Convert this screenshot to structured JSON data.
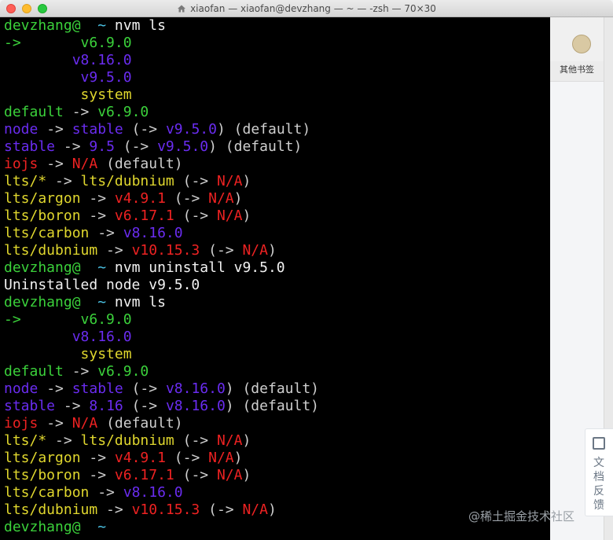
{
  "window": {
    "title": "xiaofan — xiaofan@devzhang — ~ — -zsh — 70×30"
  },
  "browser_bg": {
    "bookmark_label": "其他书签",
    "feedback_label": "文档反馈"
  },
  "watermark": "@稀土掘金技术社区",
  "colors": {
    "prompt_green": "#3bd13b",
    "version_purple": "#6a2cf0",
    "yellow": "#e0d72e",
    "red": "#ee2222",
    "cyan": "#4cc6e8"
  },
  "terminal": {
    "lines": [
      [
        {
          "t": "devzhang@",
          "c": "c-green"
        },
        {
          "t": "  ~ ",
          "c": "c-cyan"
        },
        {
          "t": "nvm ls",
          "c": "c-white"
        }
      ],
      [
        {
          "t": "->",
          "c": "c-green"
        },
        {
          "t": "       v6.9.0",
          "c": "c-green"
        }
      ],
      [
        {
          "t": "        v8.16.0",
          "c": "c-purple"
        }
      ],
      [
        {
          "t": "         v9.5.0",
          "c": "c-purple"
        }
      ],
      [
        {
          "t": "         system",
          "c": "c-yellow"
        }
      ],
      [
        {
          "t": "default",
          "c": "c-green"
        },
        {
          "t": " -> ",
          "c": "c-dim"
        },
        {
          "t": "v6.9.0",
          "c": "c-green"
        }
      ],
      [
        {
          "t": "node",
          "c": "c-purple"
        },
        {
          "t": " -> ",
          "c": "c-dim"
        },
        {
          "t": "stable",
          "c": "c-purple"
        },
        {
          "t": " (-> ",
          "c": "c-dim"
        },
        {
          "t": "v9.5.0",
          "c": "c-purple"
        },
        {
          "t": ") (default)",
          "c": "c-dim"
        }
      ],
      [
        {
          "t": "stable",
          "c": "c-purple"
        },
        {
          "t": " -> ",
          "c": "c-dim"
        },
        {
          "t": "9.5",
          "c": "c-purple"
        },
        {
          "t": " (-> ",
          "c": "c-dim"
        },
        {
          "t": "v9.5.0",
          "c": "c-purple"
        },
        {
          "t": ") (default)",
          "c": "c-dim"
        }
      ],
      [
        {
          "t": "iojs",
          "c": "c-red"
        },
        {
          "t": " -> ",
          "c": "c-dim"
        },
        {
          "t": "N/A",
          "c": "c-red"
        },
        {
          "t": " (default)",
          "c": "c-dim"
        }
      ],
      [
        {
          "t": "lts/*",
          "c": "c-yellow"
        },
        {
          "t": " -> ",
          "c": "c-dim"
        },
        {
          "t": "lts/dubnium",
          "c": "c-yellow"
        },
        {
          "t": " (-> ",
          "c": "c-dim"
        },
        {
          "t": "N/A",
          "c": "c-red"
        },
        {
          "t": ")",
          "c": "c-dim"
        }
      ],
      [
        {
          "t": "lts/argon",
          "c": "c-yellow"
        },
        {
          "t": " -> ",
          "c": "c-dim"
        },
        {
          "t": "v4.9.1",
          "c": "c-red"
        },
        {
          "t": " (-> ",
          "c": "c-dim"
        },
        {
          "t": "N/A",
          "c": "c-red"
        },
        {
          "t": ")",
          "c": "c-dim"
        }
      ],
      [
        {
          "t": "lts/boron",
          "c": "c-yellow"
        },
        {
          "t": " -> ",
          "c": "c-dim"
        },
        {
          "t": "v6.17.1",
          "c": "c-red"
        },
        {
          "t": " (-> ",
          "c": "c-dim"
        },
        {
          "t": "N/A",
          "c": "c-red"
        },
        {
          "t": ")",
          "c": "c-dim"
        }
      ],
      [
        {
          "t": "lts/carbon",
          "c": "c-yellow"
        },
        {
          "t": " -> ",
          "c": "c-dim"
        },
        {
          "t": "v8.16.0",
          "c": "c-purple"
        }
      ],
      [
        {
          "t": "lts/dubnium",
          "c": "c-yellow"
        },
        {
          "t": " -> ",
          "c": "c-dim"
        },
        {
          "t": "v10.15.3",
          "c": "c-red"
        },
        {
          "t": " (-> ",
          "c": "c-dim"
        },
        {
          "t": "N/A",
          "c": "c-red"
        },
        {
          "t": ")",
          "c": "c-dim"
        }
      ],
      [
        {
          "t": "devzhang@",
          "c": "c-green"
        },
        {
          "t": "  ~ ",
          "c": "c-cyan"
        },
        {
          "t": "nvm uninstall v9.5.0",
          "c": "c-white"
        }
      ],
      [
        {
          "t": "Uninstalled node v9.5.0",
          "c": "c-white"
        }
      ],
      [
        {
          "t": "devzhang@",
          "c": "c-green"
        },
        {
          "t": "  ~ ",
          "c": "c-cyan"
        },
        {
          "t": "nvm ls",
          "c": "c-white"
        }
      ],
      [
        {
          "t": "->",
          "c": "c-green"
        },
        {
          "t": "       v6.9.0",
          "c": "c-green"
        }
      ],
      [
        {
          "t": "        v8.16.0",
          "c": "c-purple"
        }
      ],
      [
        {
          "t": "         system",
          "c": "c-yellow"
        }
      ],
      [
        {
          "t": "default",
          "c": "c-green"
        },
        {
          "t": " -> ",
          "c": "c-dim"
        },
        {
          "t": "v6.9.0",
          "c": "c-green"
        }
      ],
      [
        {
          "t": "node",
          "c": "c-purple"
        },
        {
          "t": " -> ",
          "c": "c-dim"
        },
        {
          "t": "stable",
          "c": "c-purple"
        },
        {
          "t": " (-> ",
          "c": "c-dim"
        },
        {
          "t": "v8.16.0",
          "c": "c-purple"
        },
        {
          "t": ") (default)",
          "c": "c-dim"
        }
      ],
      [
        {
          "t": "stable",
          "c": "c-purple"
        },
        {
          "t": " -> ",
          "c": "c-dim"
        },
        {
          "t": "8.16",
          "c": "c-purple"
        },
        {
          "t": " (-> ",
          "c": "c-dim"
        },
        {
          "t": "v8.16.0",
          "c": "c-purple"
        },
        {
          "t": ") (default)",
          "c": "c-dim"
        }
      ],
      [
        {
          "t": "iojs",
          "c": "c-red"
        },
        {
          "t": " -> ",
          "c": "c-dim"
        },
        {
          "t": "N/A",
          "c": "c-red"
        },
        {
          "t": " (default)",
          "c": "c-dim"
        }
      ],
      [
        {
          "t": "lts/*",
          "c": "c-yellow"
        },
        {
          "t": " -> ",
          "c": "c-dim"
        },
        {
          "t": "lts/dubnium",
          "c": "c-yellow"
        },
        {
          "t": " (-> ",
          "c": "c-dim"
        },
        {
          "t": "N/A",
          "c": "c-red"
        },
        {
          "t": ")",
          "c": "c-dim"
        }
      ],
      [
        {
          "t": "lts/argon",
          "c": "c-yellow"
        },
        {
          "t": " -> ",
          "c": "c-dim"
        },
        {
          "t": "v4.9.1",
          "c": "c-red"
        },
        {
          "t": " (-> ",
          "c": "c-dim"
        },
        {
          "t": "N/A",
          "c": "c-red"
        },
        {
          "t": ")",
          "c": "c-dim"
        }
      ],
      [
        {
          "t": "lts/boron",
          "c": "c-yellow"
        },
        {
          "t": " -> ",
          "c": "c-dim"
        },
        {
          "t": "v6.17.1",
          "c": "c-red"
        },
        {
          "t": " (-> ",
          "c": "c-dim"
        },
        {
          "t": "N/A",
          "c": "c-red"
        },
        {
          "t": ")",
          "c": "c-dim"
        }
      ],
      [
        {
          "t": "lts/carbon",
          "c": "c-yellow"
        },
        {
          "t": " -> ",
          "c": "c-dim"
        },
        {
          "t": "v8.16.0",
          "c": "c-purple"
        }
      ],
      [
        {
          "t": "lts/dubnium",
          "c": "c-yellow"
        },
        {
          "t": " -> ",
          "c": "c-dim"
        },
        {
          "t": "v10.15.3",
          "c": "c-red"
        },
        {
          "t": " (-> ",
          "c": "c-dim"
        },
        {
          "t": "N/A",
          "c": "c-red"
        },
        {
          "t": ")",
          "c": "c-dim"
        }
      ],
      [
        {
          "t": "devzhang@",
          "c": "c-green"
        },
        {
          "t": "  ~ ",
          "c": "c-cyan"
        }
      ]
    ]
  }
}
